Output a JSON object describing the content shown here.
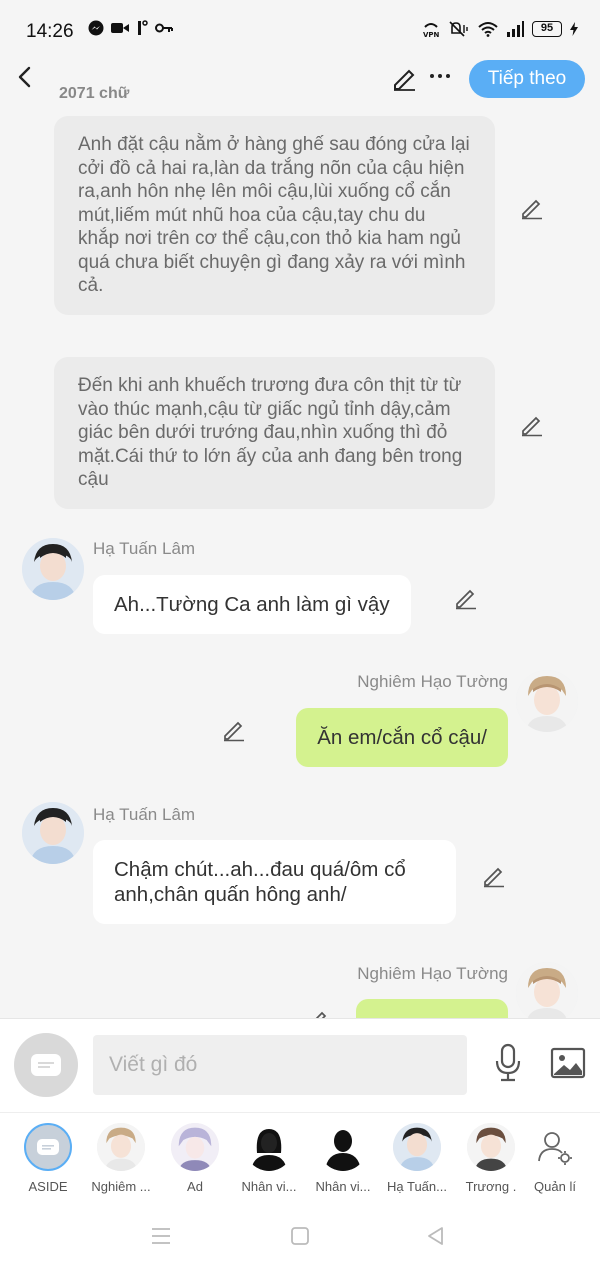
{
  "status_bar": {
    "time": "14:26",
    "battery": "95"
  },
  "header": {
    "word_count": "2071 chữ",
    "next_label": "Tiếp theo"
  },
  "messages": [
    {
      "type": "narration",
      "text": "Anh đặt cậu nằm ở hàng ghế sau đóng cửa lại cởi đồ cả hai ra,làn da trắng nõn của cậu hiện ra,anh hôn nhẹ lên môi cậu,lùi xuống cổ cắn mút,liếm mút nhũ hoa của cậu,tay chu du khắp nơi trên cơ thể cậu,con thỏ kia ham ngủ quá chưa biết chuyện gì đang xảy ra với mình cả."
    },
    {
      "type": "narration",
      "text": "Đến khi anh khuếch trương đưa côn thịt từ từ vào thúc mạnh,cậu từ giấc ngủ tỉnh dậy,cảm giác bên dưới trướng đau,nhìn xuống thì đỏ mặt.Cái thứ to lớn ấy của anh đang bên trong cậu"
    },
    {
      "type": "left",
      "speaker": "Hạ Tuấn Lâm",
      "text": "Ah...Tường Ca anh làm gì vậy"
    },
    {
      "type": "right",
      "speaker": "Nghiêm Hạo Tường",
      "text": "Ăn em/cắn cổ cậu/"
    },
    {
      "type": "left",
      "speaker": "Hạ Tuấn Lâm",
      "text": "Chậm chút...ah...đau quá/ôm cổ anh,chân quấn hông anh/"
    },
    {
      "type": "right",
      "speaker": "Nghiêm Hạo Tường",
      "text": ""
    }
  ],
  "input": {
    "placeholder": "Viết gì đó"
  },
  "characters": [
    {
      "name": "ASIDE"
    },
    {
      "name": "Nghiêm ..."
    },
    {
      "name": "Ad"
    },
    {
      "name": "Nhân vi..."
    },
    {
      "name": "Nhân vi..."
    },
    {
      "name": "Hạ Tuấn..."
    },
    {
      "name": "Trương ."
    },
    {
      "name": "Quản lí"
    }
  ],
  "colors": {
    "accent": "#5aaef5",
    "right_bubble": "#d4f28f",
    "narration": "#ebebeb"
  }
}
